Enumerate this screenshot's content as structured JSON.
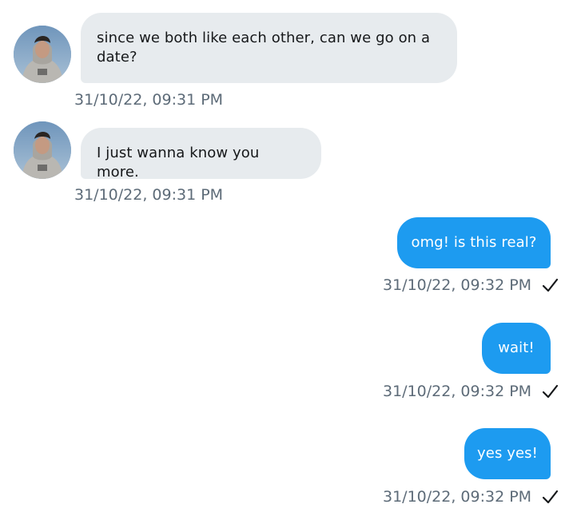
{
  "messages": [
    {
      "direction": "incoming",
      "text": "since we both like each other, can we go on a date?",
      "timestamp": "31/10/22, 09:31 PM"
    },
    {
      "direction": "incoming",
      "text": "I just wanna know you more.",
      "timestamp": "31/10/22, 09:31 PM"
    },
    {
      "direction": "outgoing",
      "text": "omg! is this real?",
      "timestamp": "31/10/22, 09:32 PM",
      "status_icon": "check-icon"
    },
    {
      "direction": "outgoing",
      "text": "wait!",
      "timestamp": "31/10/22, 09:32 PM",
      "status_icon": "check-icon"
    },
    {
      "direction": "outgoing",
      "text": "yes yes!",
      "timestamp": "31/10/22, 09:32 PM",
      "status_icon": "check-icon"
    }
  ],
  "colors": {
    "incoming_bubble": "#e7ebee",
    "outgoing_bubble": "#1d9bf0",
    "timestamp": "#5d6b78"
  }
}
